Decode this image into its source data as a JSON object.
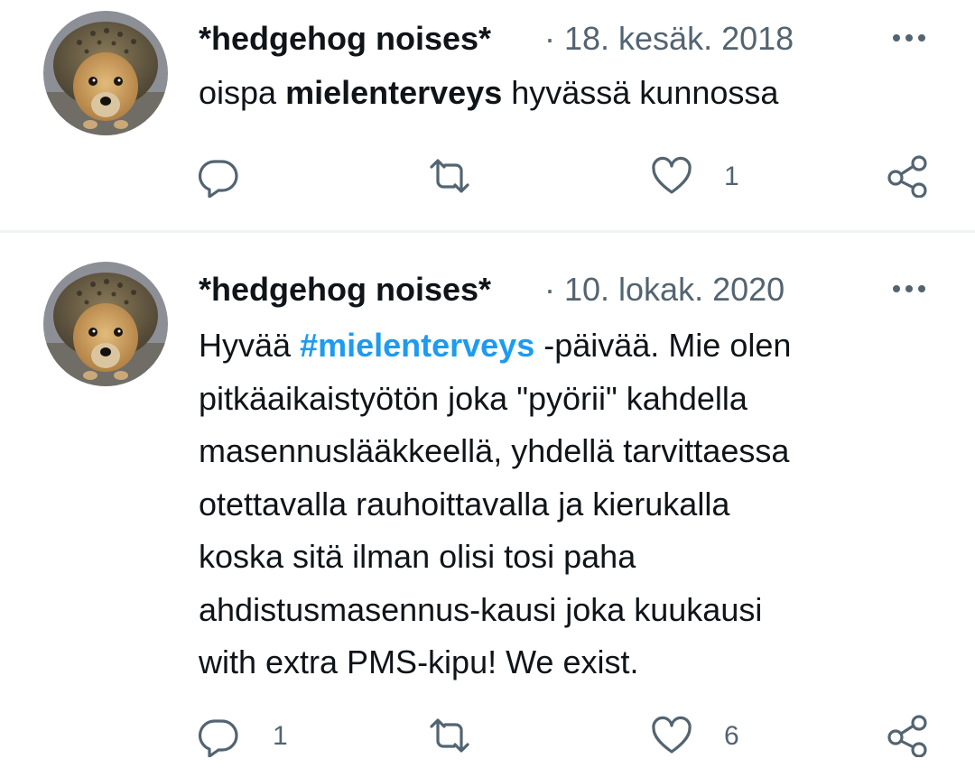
{
  "tweets": [
    {
      "author": "*hedgehog noises*",
      "date": "· 18. kesäk. 2018",
      "text_parts": [
        "oispa ",
        "mielenterveys",
        " hyvässä kunnossa"
      ],
      "reply_count": "",
      "like_count": "1"
    },
    {
      "author": "*hedgehog noises*",
      "date": "· 10. lokak. 2020",
      "text_first_line": [
        "Hyvää ",
        "#mielenterveys",
        " -päivää. Mie olen"
      ],
      "text_lines": [
        "pitkäaikaistyötön joka \"pyörii\" kahdella",
        "masennuslääkkeellä, yhdellä tarvittaessa",
        "otettavalla rauhoittavalla ja kierukalla",
        "koska sitä ilman olisi tosi paha",
        "ahdistusmasennus-kausi joka kuukausi",
        "with extra PMS-kipu! We exist."
      ],
      "reply_count": "1",
      "like_count": "6"
    }
  ],
  "icons": [
    "reply-icon",
    "retweet-icon",
    "like-icon",
    "share-icon",
    "more-icon"
  ],
  "colors": {
    "text": "#0f1419",
    "secondary": "#536471",
    "accent": "#1d9bf0",
    "divider": "#eff3f4"
  }
}
